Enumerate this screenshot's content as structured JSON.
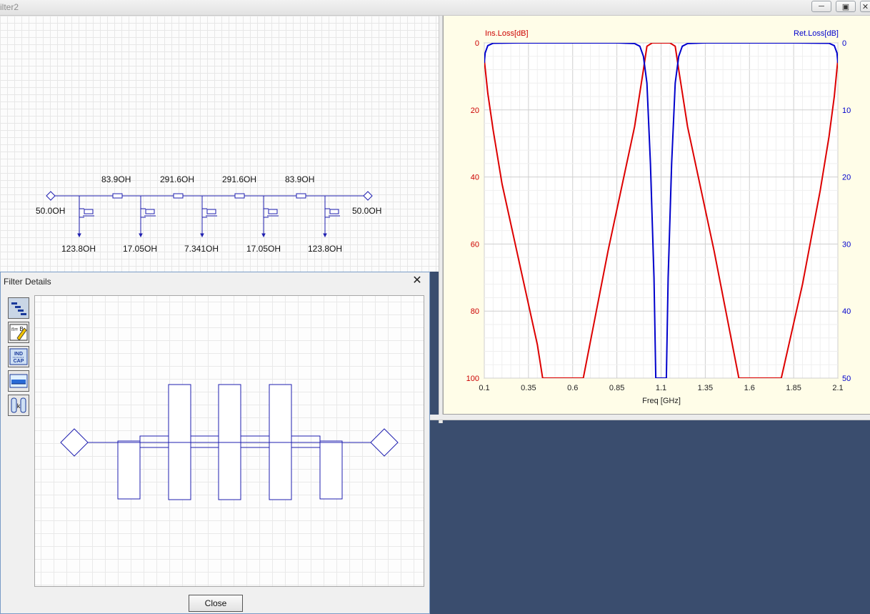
{
  "window": {
    "title": "ilter2"
  },
  "schematic": {
    "series_labels": [
      "83.9OH",
      "291.6OH",
      "291.6OH",
      "83.9OH"
    ],
    "shunt_labels": [
      "123.8OH",
      "17.05OH",
      "7.341OH",
      "17.05OH",
      "123.8OH"
    ],
    "port_left": "50.0OH",
    "port_right": "50.0OH"
  },
  "dialog": {
    "title": "Filter Details",
    "close_button": "Close",
    "toolbar": [
      {
        "name": "layout-tool",
        "icon": "layout-icon"
      },
      {
        "name": "edit-tool",
        "icon": "edit-pencil-icon",
        "text": "n=\nB"
      },
      {
        "name": "ind-cap-tool",
        "icon": "ind-cap-icon",
        "text": "IND\nCAP"
      },
      {
        "name": "response-tool",
        "icon": "response-icon"
      },
      {
        "name": "coupling-tool",
        "icon": "coupling-icon",
        "text": "k"
      }
    ]
  },
  "chart_data": {
    "type": "line",
    "xlabel": "Freq [GHz]",
    "ylabel": "Ins.Loss[dB]",
    "ylabel_right": "Ret.Loss[dB]",
    "xlim": [
      0.1,
      2.1
    ],
    "ylim": [
      0,
      100
    ],
    "ylim_right": [
      0,
      50
    ],
    "x_ticks": [
      "0.1",
      "0.35",
      "0.6",
      "0.85",
      "1.1",
      "1.35",
      "1.6",
      "1.85",
      "2.1"
    ],
    "y_ticks": [
      "0",
      "20",
      "40",
      "60",
      "80",
      "100"
    ],
    "y_ticks_right": [
      "0",
      "10",
      "20",
      "30",
      "40",
      "50"
    ],
    "grid": true,
    "series": [
      {
        "name": "Ins.Loss[dB]",
        "axis": "left",
        "color": "#dd0000",
        "x": [
          0.1,
          0.12,
          0.15,
          0.2,
          0.3,
          0.4,
          0.43,
          0.66,
          0.8,
          0.95,
          1.0,
          1.02,
          1.05,
          1.1,
          1.15,
          1.18,
          1.2,
          1.25,
          1.4,
          1.54,
          1.78,
          1.9,
          2.0,
          2.05,
          2.08,
          2.1
        ],
        "y": [
          5,
          15,
          26,
          42,
          66,
          90,
          100,
          100,
          62,
          25,
          8,
          1,
          0,
          0,
          0,
          1,
          8,
          25,
          62,
          100,
          100,
          72,
          44,
          28,
          16,
          5
        ]
      },
      {
        "name": "Ret.Loss[dB]",
        "axis": "right",
        "color": "#0000cc",
        "x": [
          0.1,
          0.105,
          0.12,
          0.15,
          0.3,
          0.6,
          0.85,
          0.95,
          0.98,
          1.0,
          1.02,
          1.04,
          1.06,
          1.07,
          1.09,
          1.11,
          1.13,
          1.14,
          1.16,
          1.18,
          1.2,
          1.22,
          1.25,
          1.35,
          1.6,
          1.85,
          2.05,
          2.08,
          2.095,
          2.1
        ],
        "y": [
          3,
          1.5,
          0.4,
          0.05,
          0,
          0,
          0,
          0.1,
          0.5,
          2,
          6,
          18,
          35,
          50,
          50,
          50,
          50,
          35,
          18,
          6,
          2,
          0.5,
          0.1,
          0,
          0,
          0,
          0.05,
          0.4,
          1.5,
          3
        ]
      }
    ]
  }
}
